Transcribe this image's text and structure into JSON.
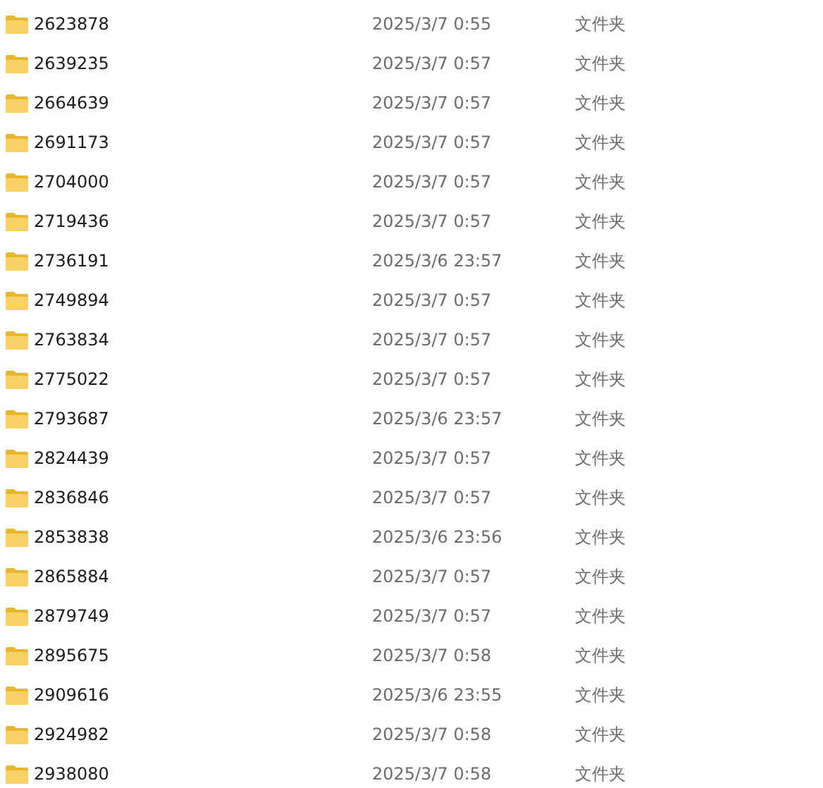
{
  "files": [
    {
      "name": "2623878",
      "modified": "2025/3/7 0:55",
      "type": "文件夹"
    },
    {
      "name": "2639235",
      "modified": "2025/3/7 0:57",
      "type": "文件夹"
    },
    {
      "name": "2664639",
      "modified": "2025/3/7 0:57",
      "type": "文件夹"
    },
    {
      "name": "2691173",
      "modified": "2025/3/7 0:57",
      "type": "文件夹"
    },
    {
      "name": "2704000",
      "modified": "2025/3/7 0:57",
      "type": "文件夹"
    },
    {
      "name": "2719436",
      "modified": "2025/3/7 0:57",
      "type": "文件夹"
    },
    {
      "name": "2736191",
      "modified": "2025/3/6 23:57",
      "type": "文件夹"
    },
    {
      "name": "2749894",
      "modified": "2025/3/7 0:57",
      "type": "文件夹"
    },
    {
      "name": "2763834",
      "modified": "2025/3/7 0:57",
      "type": "文件夹"
    },
    {
      "name": "2775022",
      "modified": "2025/3/7 0:57",
      "type": "文件夹"
    },
    {
      "name": "2793687",
      "modified": "2025/3/6 23:57",
      "type": "文件夹"
    },
    {
      "name": "2824439",
      "modified": "2025/3/7 0:57",
      "type": "文件夹"
    },
    {
      "name": "2836846",
      "modified": "2025/3/7 0:57",
      "type": "文件夹"
    },
    {
      "name": "2853838",
      "modified": "2025/3/6 23:56",
      "type": "文件夹"
    },
    {
      "name": "2865884",
      "modified": "2025/3/7 0:57",
      "type": "文件夹"
    },
    {
      "name": "2879749",
      "modified": "2025/3/7 0:57",
      "type": "文件夹"
    },
    {
      "name": "2895675",
      "modified": "2025/3/7 0:58",
      "type": "文件夹"
    },
    {
      "name": "2909616",
      "modified": "2025/3/6 23:55",
      "type": "文件夹"
    },
    {
      "name": "2924982",
      "modified": "2025/3/7 0:58",
      "type": "文件夹"
    },
    {
      "name": "2938080",
      "modified": "2025/3/7 0:58",
      "type": "文件夹"
    }
  ]
}
